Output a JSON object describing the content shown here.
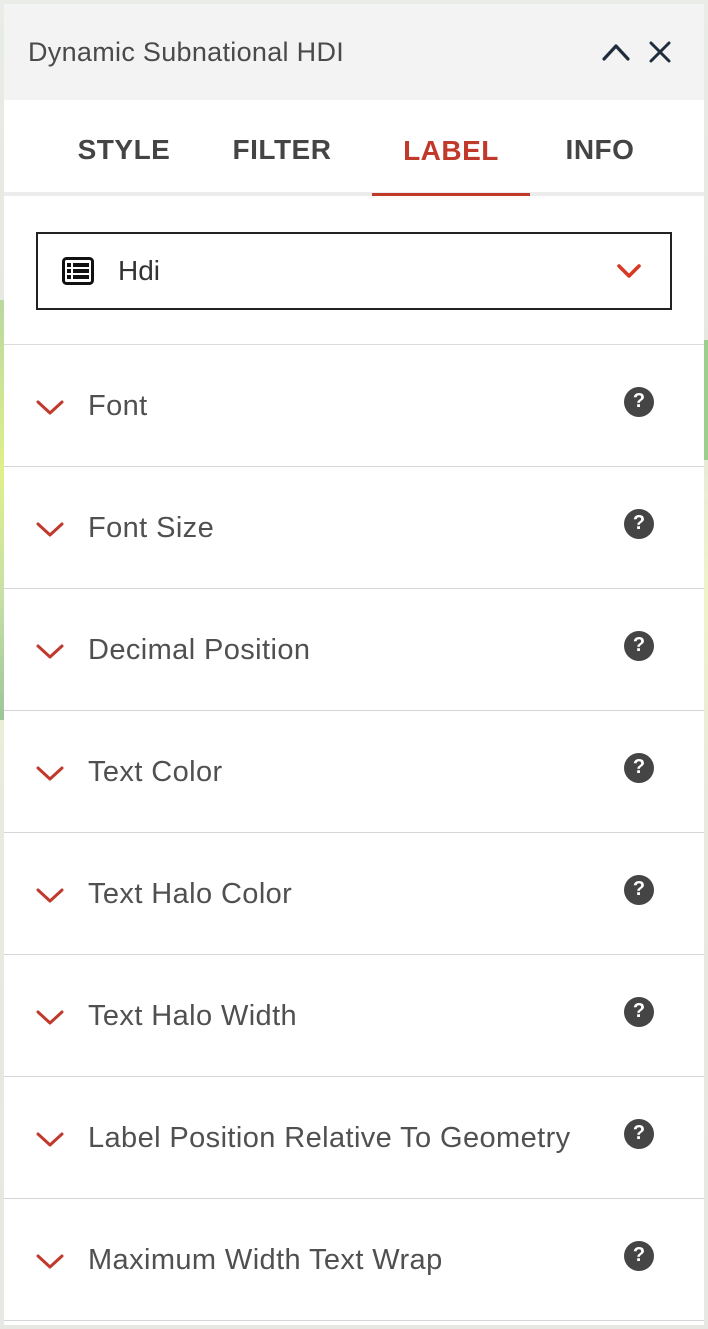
{
  "panel": {
    "title": "Dynamic Subnational HDI"
  },
  "tabs": [
    {
      "label": "STYLE",
      "active": false
    },
    {
      "label": "FILTER",
      "active": false
    },
    {
      "label": "LABEL",
      "active": true
    },
    {
      "label": "INFO",
      "active": false
    }
  ],
  "field_select": {
    "value": "Hdi",
    "icon": "table-list-icon"
  },
  "sections": [
    {
      "label": "Font"
    },
    {
      "label": "Font Size"
    },
    {
      "label": "Decimal Position"
    },
    {
      "label": "Text Color"
    },
    {
      "label": "Text Halo Color"
    },
    {
      "label": "Text Halo Width"
    },
    {
      "label": "Label Position Relative To Geometry"
    },
    {
      "label": "Maximum Width Text Wrap"
    }
  ],
  "help_glyph": "?",
  "colors": {
    "accent": "#c0392b",
    "header_bg": "#f3f3f3",
    "help_icon_bg": "#454545"
  }
}
